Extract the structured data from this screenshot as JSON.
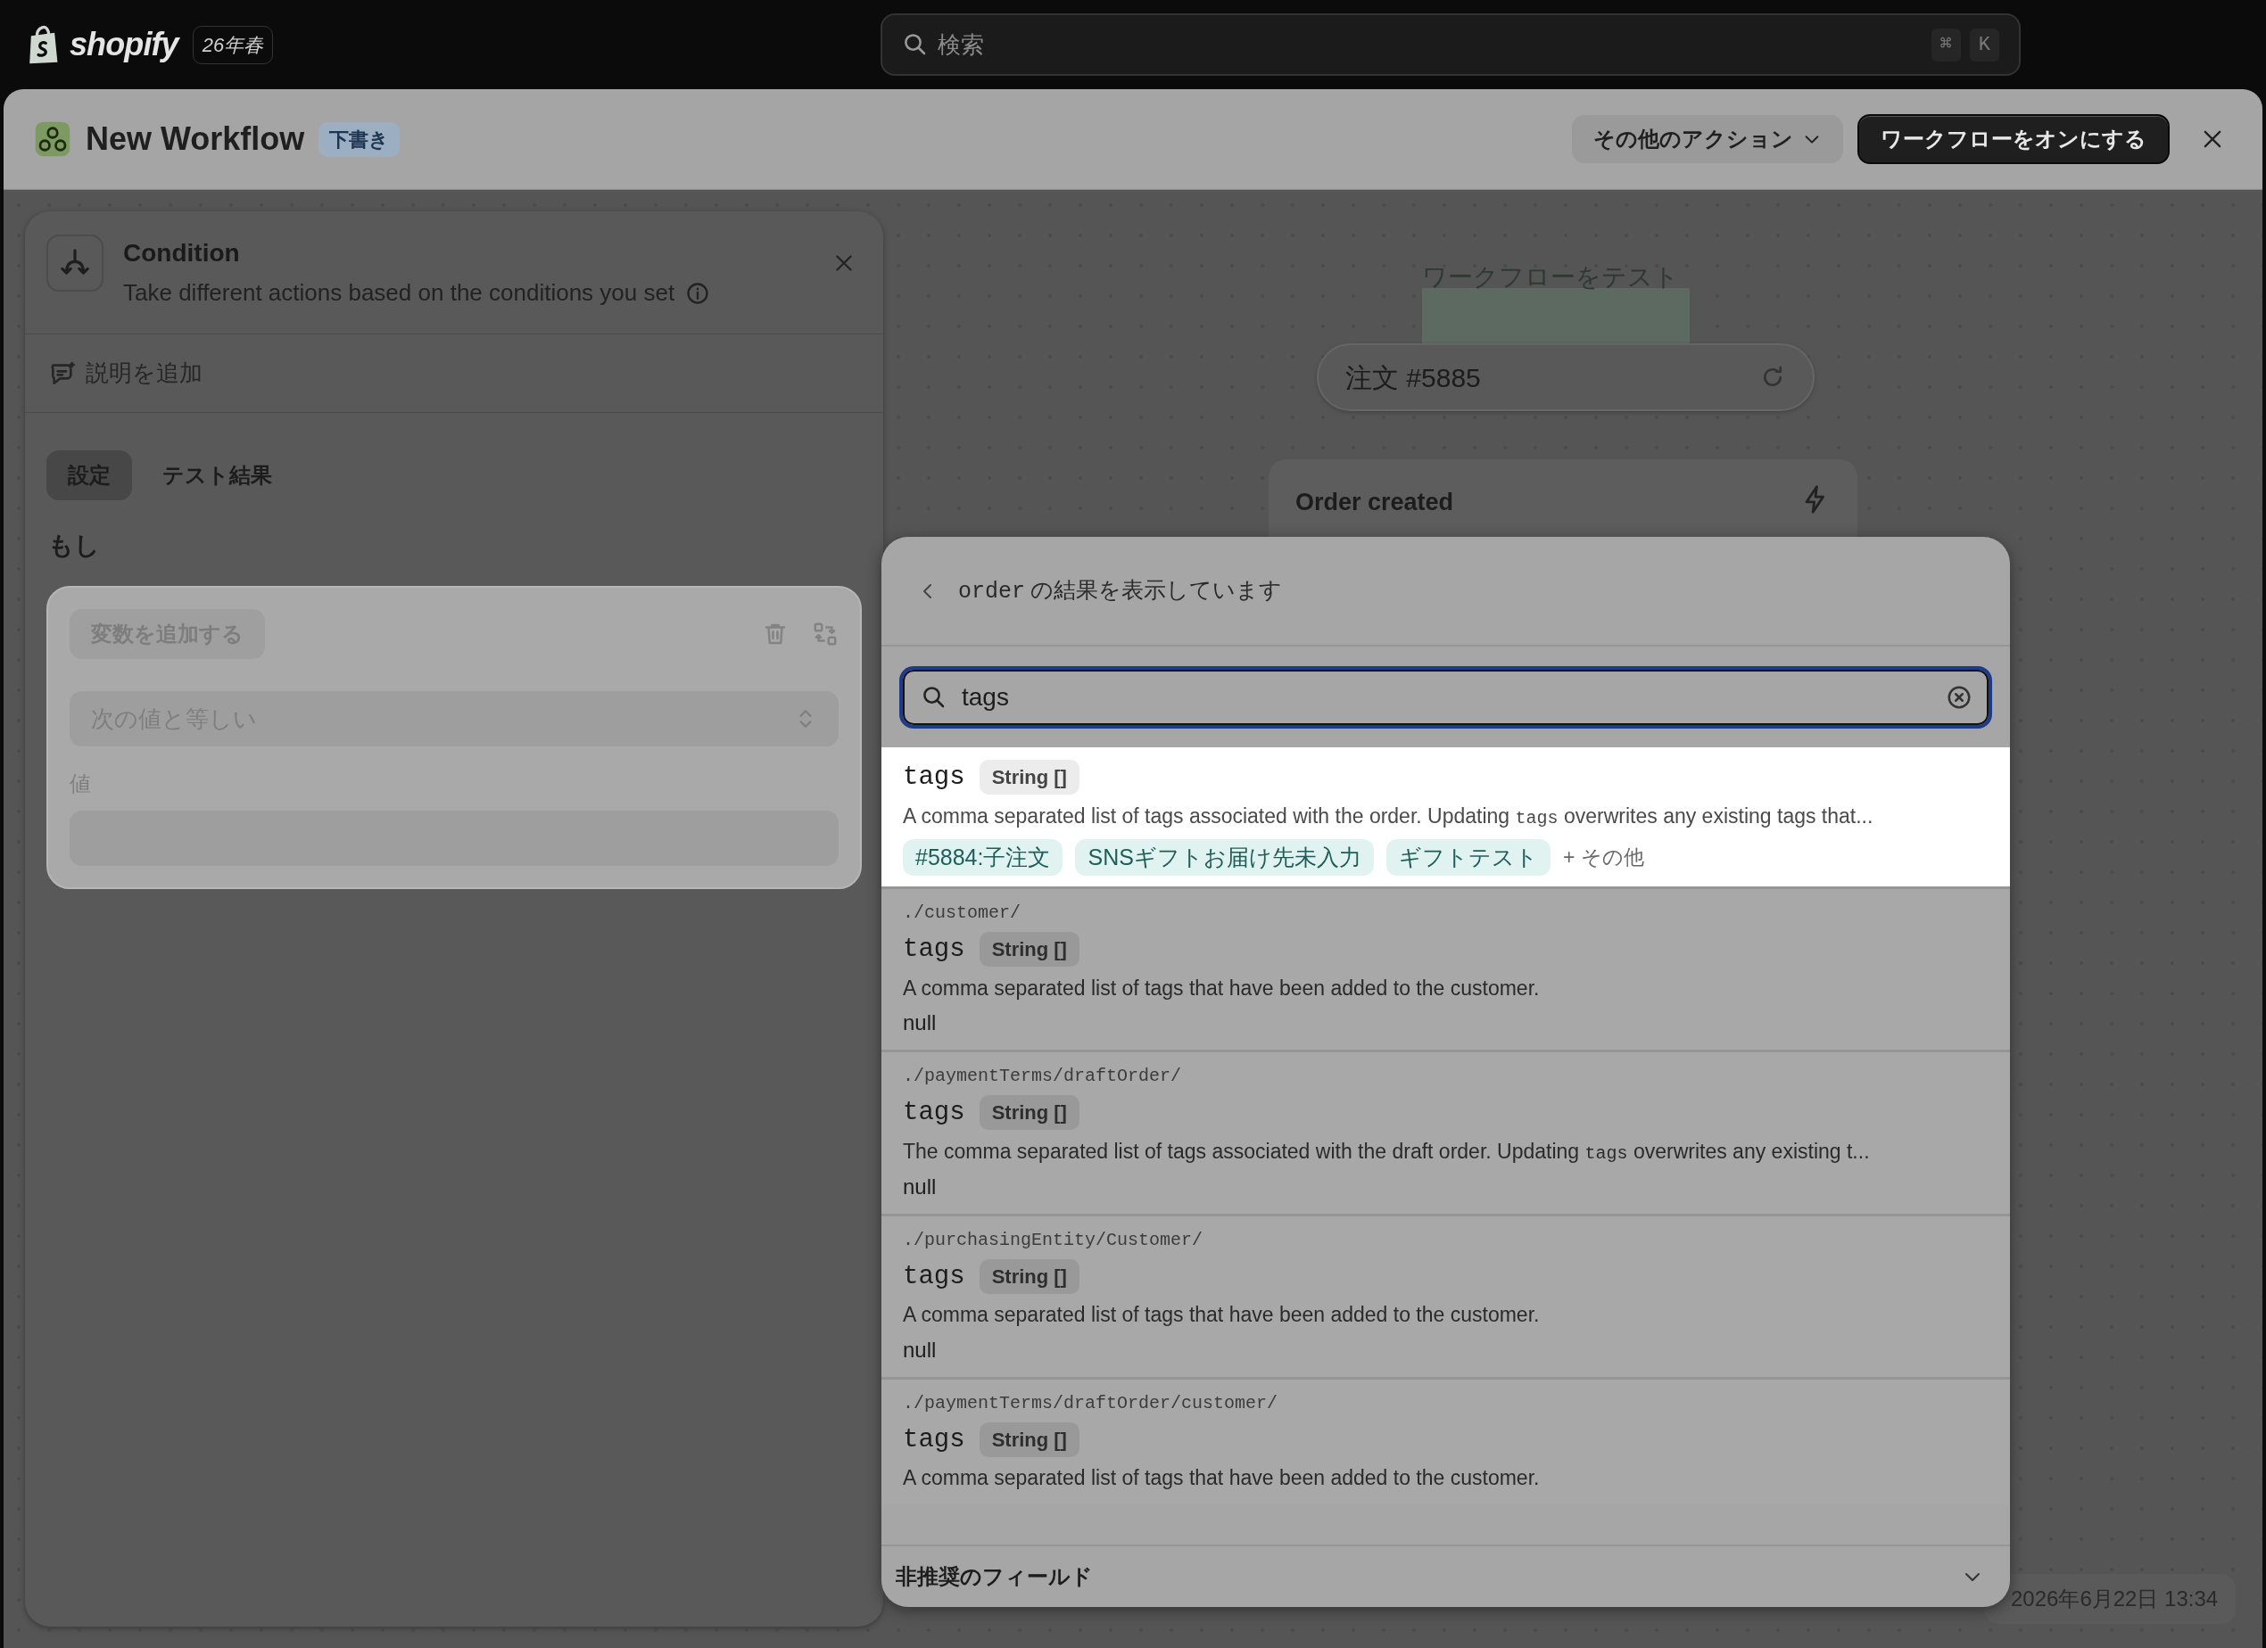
{
  "top_bar": {
    "logo": "shopify",
    "edition": "26年春",
    "search": {
      "placeholder": "検索",
      "shortcut": [
        "⌘",
        "K"
      ]
    }
  },
  "window": {
    "title": "New Workflow",
    "status": "下書き",
    "actions": [
      {
        "label": "その他のアクション",
        "kind": "menu"
      },
      {
        "label": "ワークフローをオンにする",
        "kind": "primary"
      }
    ]
  },
  "panel": {
    "title": "Condition",
    "subtitle": "Take different actions based on the conditions you set",
    "add_description": "説明を追加",
    "tabs": [
      {
        "label": "設定",
        "selected": true
      },
      {
        "label": "テスト結果",
        "selected": false
      }
    ],
    "if_label": "もし",
    "condition": {
      "add_variable": "変数を追加する",
      "operator": "次の値と等しい",
      "value_label": "値"
    }
  },
  "canvas": {
    "test_label": "ワークフローをテスト",
    "order": "注文 #5885",
    "trigger": "Order created",
    "timestamp": "2026年6月22日 13:34"
  },
  "picker": {
    "header_code": "order",
    "header_text": "の結果を表示しています",
    "search": {
      "value": "tags"
    },
    "results": [
      {
        "selected": true,
        "name": "tags",
        "type": "String []",
        "description": [
          {
            "kind": "text",
            "text": "A comma separated list of tags associated with the order. Updating "
          },
          {
            "kind": "code",
            "text": "tags"
          },
          {
            "kind": "text",
            "text": " overwrites any existing tags that..."
          }
        ],
        "tags": [
          "#5884:子注文",
          "SNSギフトお届け先未入力",
          "ギフトテスト"
        ],
        "more": "+ その他"
      },
      {
        "selected": false,
        "path": "./customer/",
        "name": "tags",
        "type": "String []",
        "description": [
          {
            "kind": "text",
            "text": "A comma separated list of tags that have been added to the customer."
          }
        ],
        "value": "null"
      },
      {
        "selected": false,
        "path": "./paymentTerms/draftOrder/",
        "name": "tags",
        "type": "String []",
        "description": [
          {
            "kind": "text",
            "text": "The comma separated list of tags associated with the draft order. Updating "
          },
          {
            "kind": "code",
            "text": "tags"
          },
          {
            "kind": "text",
            "text": " overwrites any existing t..."
          }
        ],
        "value": "null"
      },
      {
        "selected": false,
        "path": "./purchasingEntity/Customer/",
        "name": "tags",
        "type": "String []",
        "description": [
          {
            "kind": "text",
            "text": "A comma separated list of tags that have been added to the customer."
          }
        ],
        "value": "null"
      },
      {
        "selected": false,
        "path": "./paymentTerms/draftOrder/customer/",
        "name": "tags",
        "type": "String []",
        "description": [
          {
            "kind": "text",
            "text": "A comma separated list of tags that have been added to the customer."
          }
        ]
      }
    ],
    "footer": "非推奨のフィールド"
  }
}
